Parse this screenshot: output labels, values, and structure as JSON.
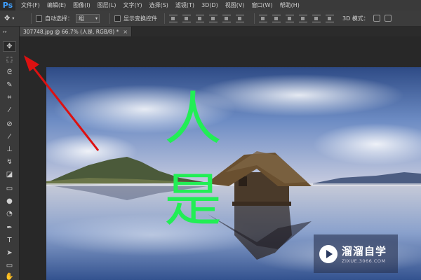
{
  "app": {
    "logo": "Ps"
  },
  "menu": [
    "文件(F)",
    "编辑(E)",
    "图像(I)",
    "图层(L)",
    "文字(Y)",
    "选择(S)",
    "滤镜(T)",
    "3D(D)",
    "视图(V)",
    "窗口(W)",
    "帮助(H)"
  ],
  "options": {
    "auto_select_label": "自动选择：",
    "auto_select_value": "组",
    "show_transform_label": "显示变换控件",
    "mode_3d_label": "3D 模式："
  },
  "document": {
    "tab_title": "307748.jpg @ 66.7% (人是, RGB/8) *",
    "close_glyph": "×"
  },
  "canvas_text": {
    "char1": "人",
    "char2": "是"
  },
  "watermark": {
    "cn": "溜溜自学",
    "en": "ZIXUE.3066.COM"
  },
  "colors": {
    "text_layer": "#22ee55",
    "arrow": "#dd1111",
    "ps_blue": "#3fa0ff"
  },
  "icons": [
    "move-tool-icon",
    "marquee-tool-icon",
    "lasso-tool-icon",
    "quick-select-icon",
    "crop-tool-icon",
    "eyedropper-icon",
    "healing-brush-icon",
    "brush-tool-icon",
    "clone-stamp-icon",
    "history-brush-icon",
    "eraser-icon",
    "gradient-tool-icon",
    "blur-tool-icon",
    "dodge-tool-icon",
    "pen-tool-icon",
    "type-tool-icon",
    "path-select-icon",
    "rectangle-tool-icon",
    "hand-tool-icon"
  ]
}
